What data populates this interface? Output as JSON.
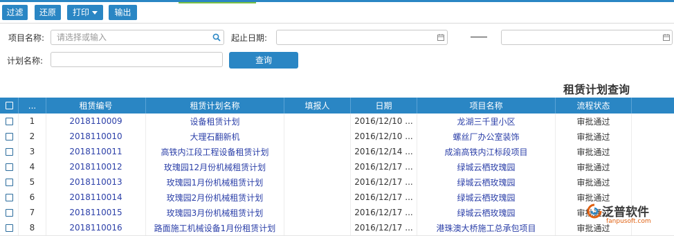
{
  "toolbar": {
    "filter_label": "过滤",
    "restore_label": "还原",
    "print_label": "打印",
    "export_label": "输出"
  },
  "search": {
    "project_label": "项目名称:",
    "project_placeholder": "请选择或输入",
    "date_label": "起止日期:",
    "date_separator": "——",
    "plan_label": "计划名称:",
    "query_label": "查询"
  },
  "page_title": "租赁计划查询",
  "table": {
    "headers": [
      "...",
      "租赁编号",
      "租赁计划名称",
      "填报人",
      "日期",
      "项目名称",
      "流程状态"
    ],
    "rows": [
      {
        "no": "1",
        "code": "2018110009",
        "plan": "设备租赁计划",
        "filler": "",
        "date": "2016/12/10 ...",
        "project": "龙湖三千里小区",
        "status": "审批通过"
      },
      {
        "no": "2",
        "code": "2018110010",
        "plan": "大理石翻新机",
        "filler": "",
        "date": "2016/12/10 ...",
        "project": "螺丝厂办公室装饰",
        "status": "审批通过"
      },
      {
        "no": "3",
        "code": "2018110011",
        "plan": "高铁内江段工程设备租赁计划",
        "filler": "",
        "date": "2016/12/14 ...",
        "project": "成渝高铁内江标段项目",
        "status": "审批通过"
      },
      {
        "no": "4",
        "code": "2018110012",
        "plan": "玫瑰园12月份机械租赁计划",
        "filler": "",
        "date": "2016/12/17 ...",
        "project": "绿城云栖玫瑰园",
        "status": "审批通过"
      },
      {
        "no": "5",
        "code": "2018110013",
        "plan": "玫瑰园1月份机械租赁计划",
        "filler": "",
        "date": "2016/12/17 ...",
        "project": "绿城云栖玫瑰园",
        "status": "审批通过"
      },
      {
        "no": "6",
        "code": "2018110014",
        "plan": "玫瑰园2月份机械租赁计划",
        "filler": "",
        "date": "2016/12/17 ...",
        "project": "绿城云栖玫瑰园",
        "status": "审批通过"
      },
      {
        "no": "7",
        "code": "2018110015",
        "plan": "玫瑰园3月份机械租赁计划",
        "filler": "",
        "date": "2016/12/17 ...",
        "project": "绿城云栖玫瑰园",
        "status": "审批通过"
      },
      {
        "no": "8",
        "code": "2018110016",
        "plan": "路面施工机械设备1月份租赁计划",
        "filler": "",
        "date": "2016/12/17 ...",
        "project": "港珠澳大桥施工总承包项目",
        "status": "审批通过"
      }
    ]
  },
  "watermark": {
    "brand": "泛普软件",
    "url": "fanpusoft.com"
  },
  "colors": {
    "accent": "#2a86c4",
    "link": "#2b3fa8"
  },
  "icons": [
    "search-icon",
    "calendar-icon",
    "chevron-down-icon",
    "checkbox-icon"
  ]
}
